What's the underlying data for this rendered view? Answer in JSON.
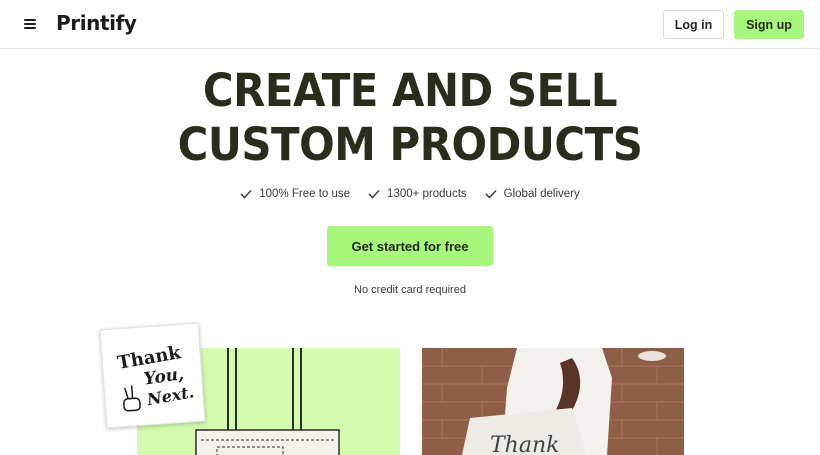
{
  "header": {
    "menu_icon": "hamburger-menu-icon",
    "logo": "Printify",
    "login_label": "Log in",
    "signup_label": "Sign up"
  },
  "hero": {
    "title_line1": "CREATE AND SELL",
    "title_line2": "CUSTOM PRODUCTS",
    "features": [
      {
        "icon": "check-icon",
        "label": "100% Free to use"
      },
      {
        "icon": "check-icon",
        "label": "1300+ products"
      },
      {
        "icon": "check-icon",
        "label": "Global delivery"
      }
    ],
    "cta_label": "Get started for free",
    "cta_note": "No credit card required"
  },
  "images": {
    "sticker_text": [
      "Thank",
      "You,",
      "Next."
    ],
    "right_photo_text": "Thank"
  },
  "colors": {
    "accent_green": "#a6f77b",
    "light_green_bg": "#d2fbae",
    "text_dark": "#2a2c1c"
  }
}
